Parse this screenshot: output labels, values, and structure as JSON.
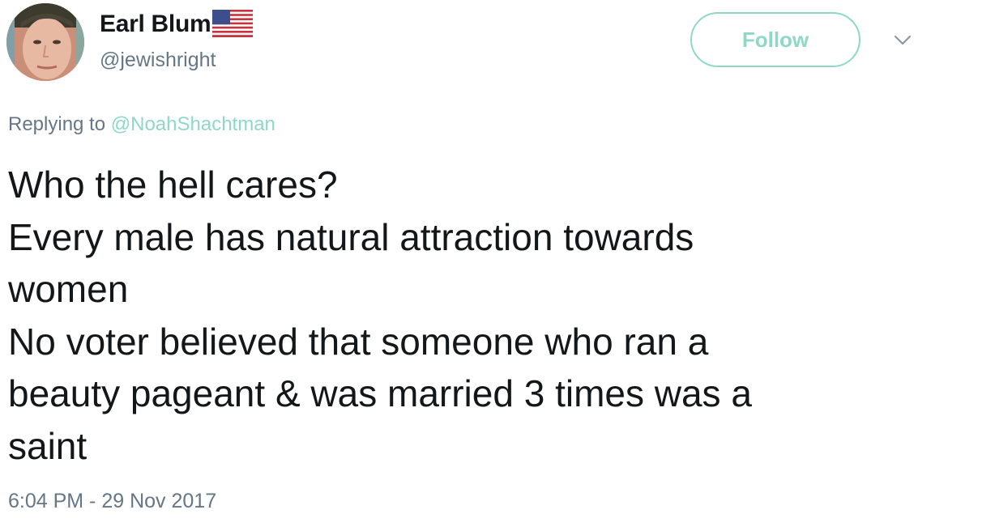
{
  "author": {
    "display_name": "Earl Blum",
    "handle": "@jewishright",
    "flag_icon": "us-flag-icon",
    "avatar_icon": "user-avatar"
  },
  "actions": {
    "follow_label": "Follow",
    "more_icon": "chevron-down-icon"
  },
  "reply": {
    "prefix": "Replying to",
    "target": "@NoahShachtman"
  },
  "tweet": {
    "lines": [
      "Who the hell cares?",
      "Every male has natural attraction towards",
      "women",
      "No voter believed that someone who ran a",
      "beauty pageant & was married 3 times was a",
      "saint"
    ],
    "timestamp": "6:04 PM - 29 Nov 2017"
  },
  "colors": {
    "accent": "#8fd8c8",
    "secondary_text": "#657786",
    "primary_text": "#14171a"
  }
}
